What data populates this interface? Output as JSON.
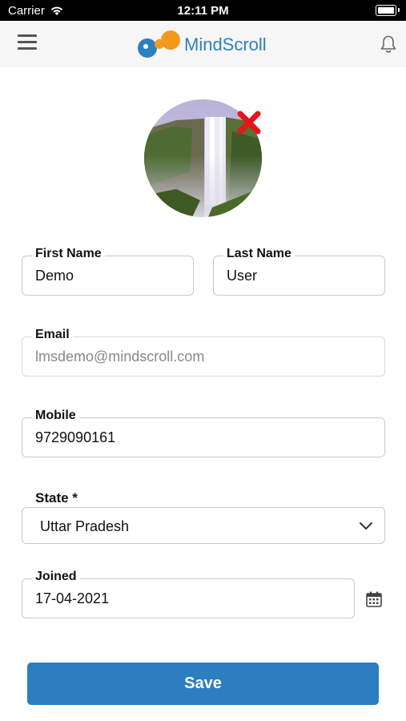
{
  "status_bar": {
    "carrier": "Carrier",
    "time": "12:11 PM"
  },
  "header": {
    "brand": "MindScroll"
  },
  "form": {
    "first_name": {
      "label": "First Name",
      "value": "Demo"
    },
    "last_name": {
      "label": "Last Name",
      "value": "User"
    },
    "email": {
      "label": "Email",
      "value": "lmsdemo@mindscroll.com"
    },
    "mobile": {
      "label": "Mobile",
      "value": "9729090161"
    },
    "state": {
      "label": "State *",
      "value": "Uttar Pradesh"
    },
    "joined": {
      "label": "Joined",
      "value": "17-04-2021"
    }
  },
  "actions": {
    "save_label": "Save"
  },
  "colors": {
    "accent": "#2b7fc0",
    "logo_orange": "#f39a1e",
    "remove": "#e3161b",
    "header_bg": "#f6f6f6"
  },
  "icons": [
    "wifi-icon",
    "battery-icon",
    "hamburger-menu-icon",
    "mindscroll-logo",
    "bell-icon",
    "remove-photo-icon",
    "chevron-down-icon",
    "calendar-icon"
  ]
}
